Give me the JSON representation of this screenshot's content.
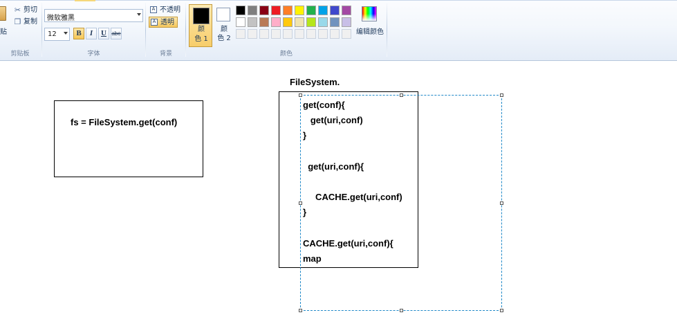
{
  "ribbon": {
    "clipboard": {
      "paste_label": "贴",
      "cut_label": "剪切",
      "copy_label": "复制",
      "group_label": "剪贴板"
    },
    "font": {
      "font_name": "微软雅黑",
      "font_size": "12",
      "bold_label": "B",
      "italic_label": "I",
      "underline_label": "U",
      "strikethrough_label": "abe",
      "group_label": "字体"
    },
    "background": {
      "opaque_label": "不透明",
      "transparent_label": "透明",
      "group_label": "背景"
    },
    "colors": {
      "color1_label": "颜\n色 1",
      "color2_label": "颜\n色 2",
      "edit_colors_label": "编辑颜色",
      "group_label": "颜色",
      "color1_value": "#000000",
      "color2_value": "#ffffff",
      "palette_row1": [
        "#000000",
        "#7f7f7f",
        "#880015",
        "#ed1c24",
        "#ff7f27",
        "#fff200",
        "#22b14c",
        "#00a2e8",
        "#3f48cc",
        "#a349a4"
      ],
      "palette_row2": [
        "#ffffff",
        "#c3c3c3",
        "#b97a57",
        "#ffaec9",
        "#ffc90e",
        "#efe4b0",
        "#b5e61d",
        "#99d9ea",
        "#7092be",
        "#c8bfe7"
      ],
      "palette_row3": [
        "#f0f0f0",
        "#f0f0f0",
        "#f0f0f0",
        "#f0f0f0",
        "#f0f0f0",
        "#f0f0f0",
        "#f0f0f0",
        "#f0f0f0",
        "#f0f0f0",
        "#f0f0f0"
      ]
    }
  },
  "canvas": {
    "left_box_text": "fs = FileSystem.get(conf)",
    "title_text": "FileSystem.",
    "code_lines": [
      "get(conf){",
      "   get(uri,conf)",
      "}",
      "",
      "  get(uri,conf){",
      "",
      "     CACHE.get(uri,conf)",
      "}",
      "",
      "CACHE.get(uri,conf){",
      "map"
    ]
  }
}
